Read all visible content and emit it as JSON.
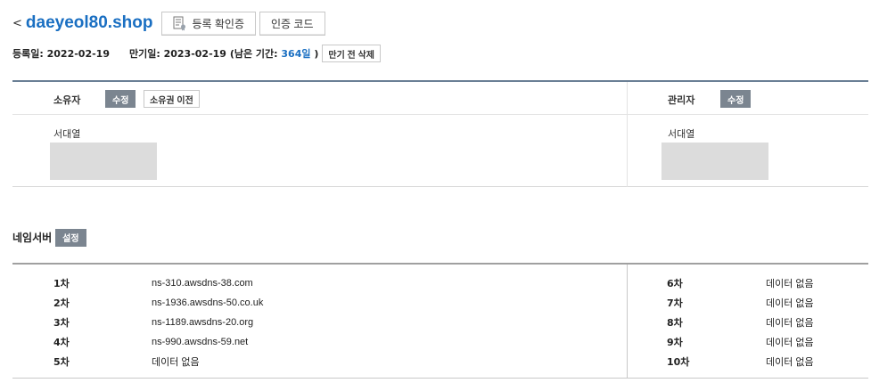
{
  "header": {
    "back_label": "<",
    "domain": "daeyeol80.shop",
    "cert_button": "등록 확인증",
    "auth_code_button": "인증 코드"
  },
  "dates": {
    "registered_label": "등록일:",
    "registered_date": "2022-02-19",
    "expiry_label": "만기일:",
    "expiry_date": "2023-02-19",
    "remaining_prefix": "(남은 기간:",
    "remaining_days": "364일",
    "remaining_suffix": ")",
    "delete_button": "만기 전 삭제"
  },
  "owner": {
    "owner_label": "소유자",
    "owner_edit": "수정",
    "transfer_button": "소유권 이전",
    "owner_name": "서대열",
    "admin_label": "관리자",
    "admin_edit": "수정",
    "admin_name": "서대열"
  },
  "nameservers": {
    "title": "네임서버",
    "setup_button": "설정",
    "left": [
      {
        "order": "1차",
        "value": "ns-310.awsdns-38.com"
      },
      {
        "order": "2차",
        "value": "ns-1936.awsdns-50.co.uk"
      },
      {
        "order": "3차",
        "value": "ns-1189.awsdns-20.org"
      },
      {
        "order": "4차",
        "value": "ns-990.awsdns-59.net"
      },
      {
        "order": "5차",
        "value": "데이터 없음"
      }
    ],
    "right": [
      {
        "order": "6차",
        "value": "데이터 없음"
      },
      {
        "order": "7차",
        "value": "데이터 없음"
      },
      {
        "order": "8차",
        "value": "데이터 없음"
      },
      {
        "order": "9차",
        "value": "데이터 없음"
      },
      {
        "order": "10차",
        "value": "데이터 없음"
      }
    ]
  },
  "colors": {
    "accent": "#1a6fc2",
    "gray_button": "#7b8590"
  }
}
